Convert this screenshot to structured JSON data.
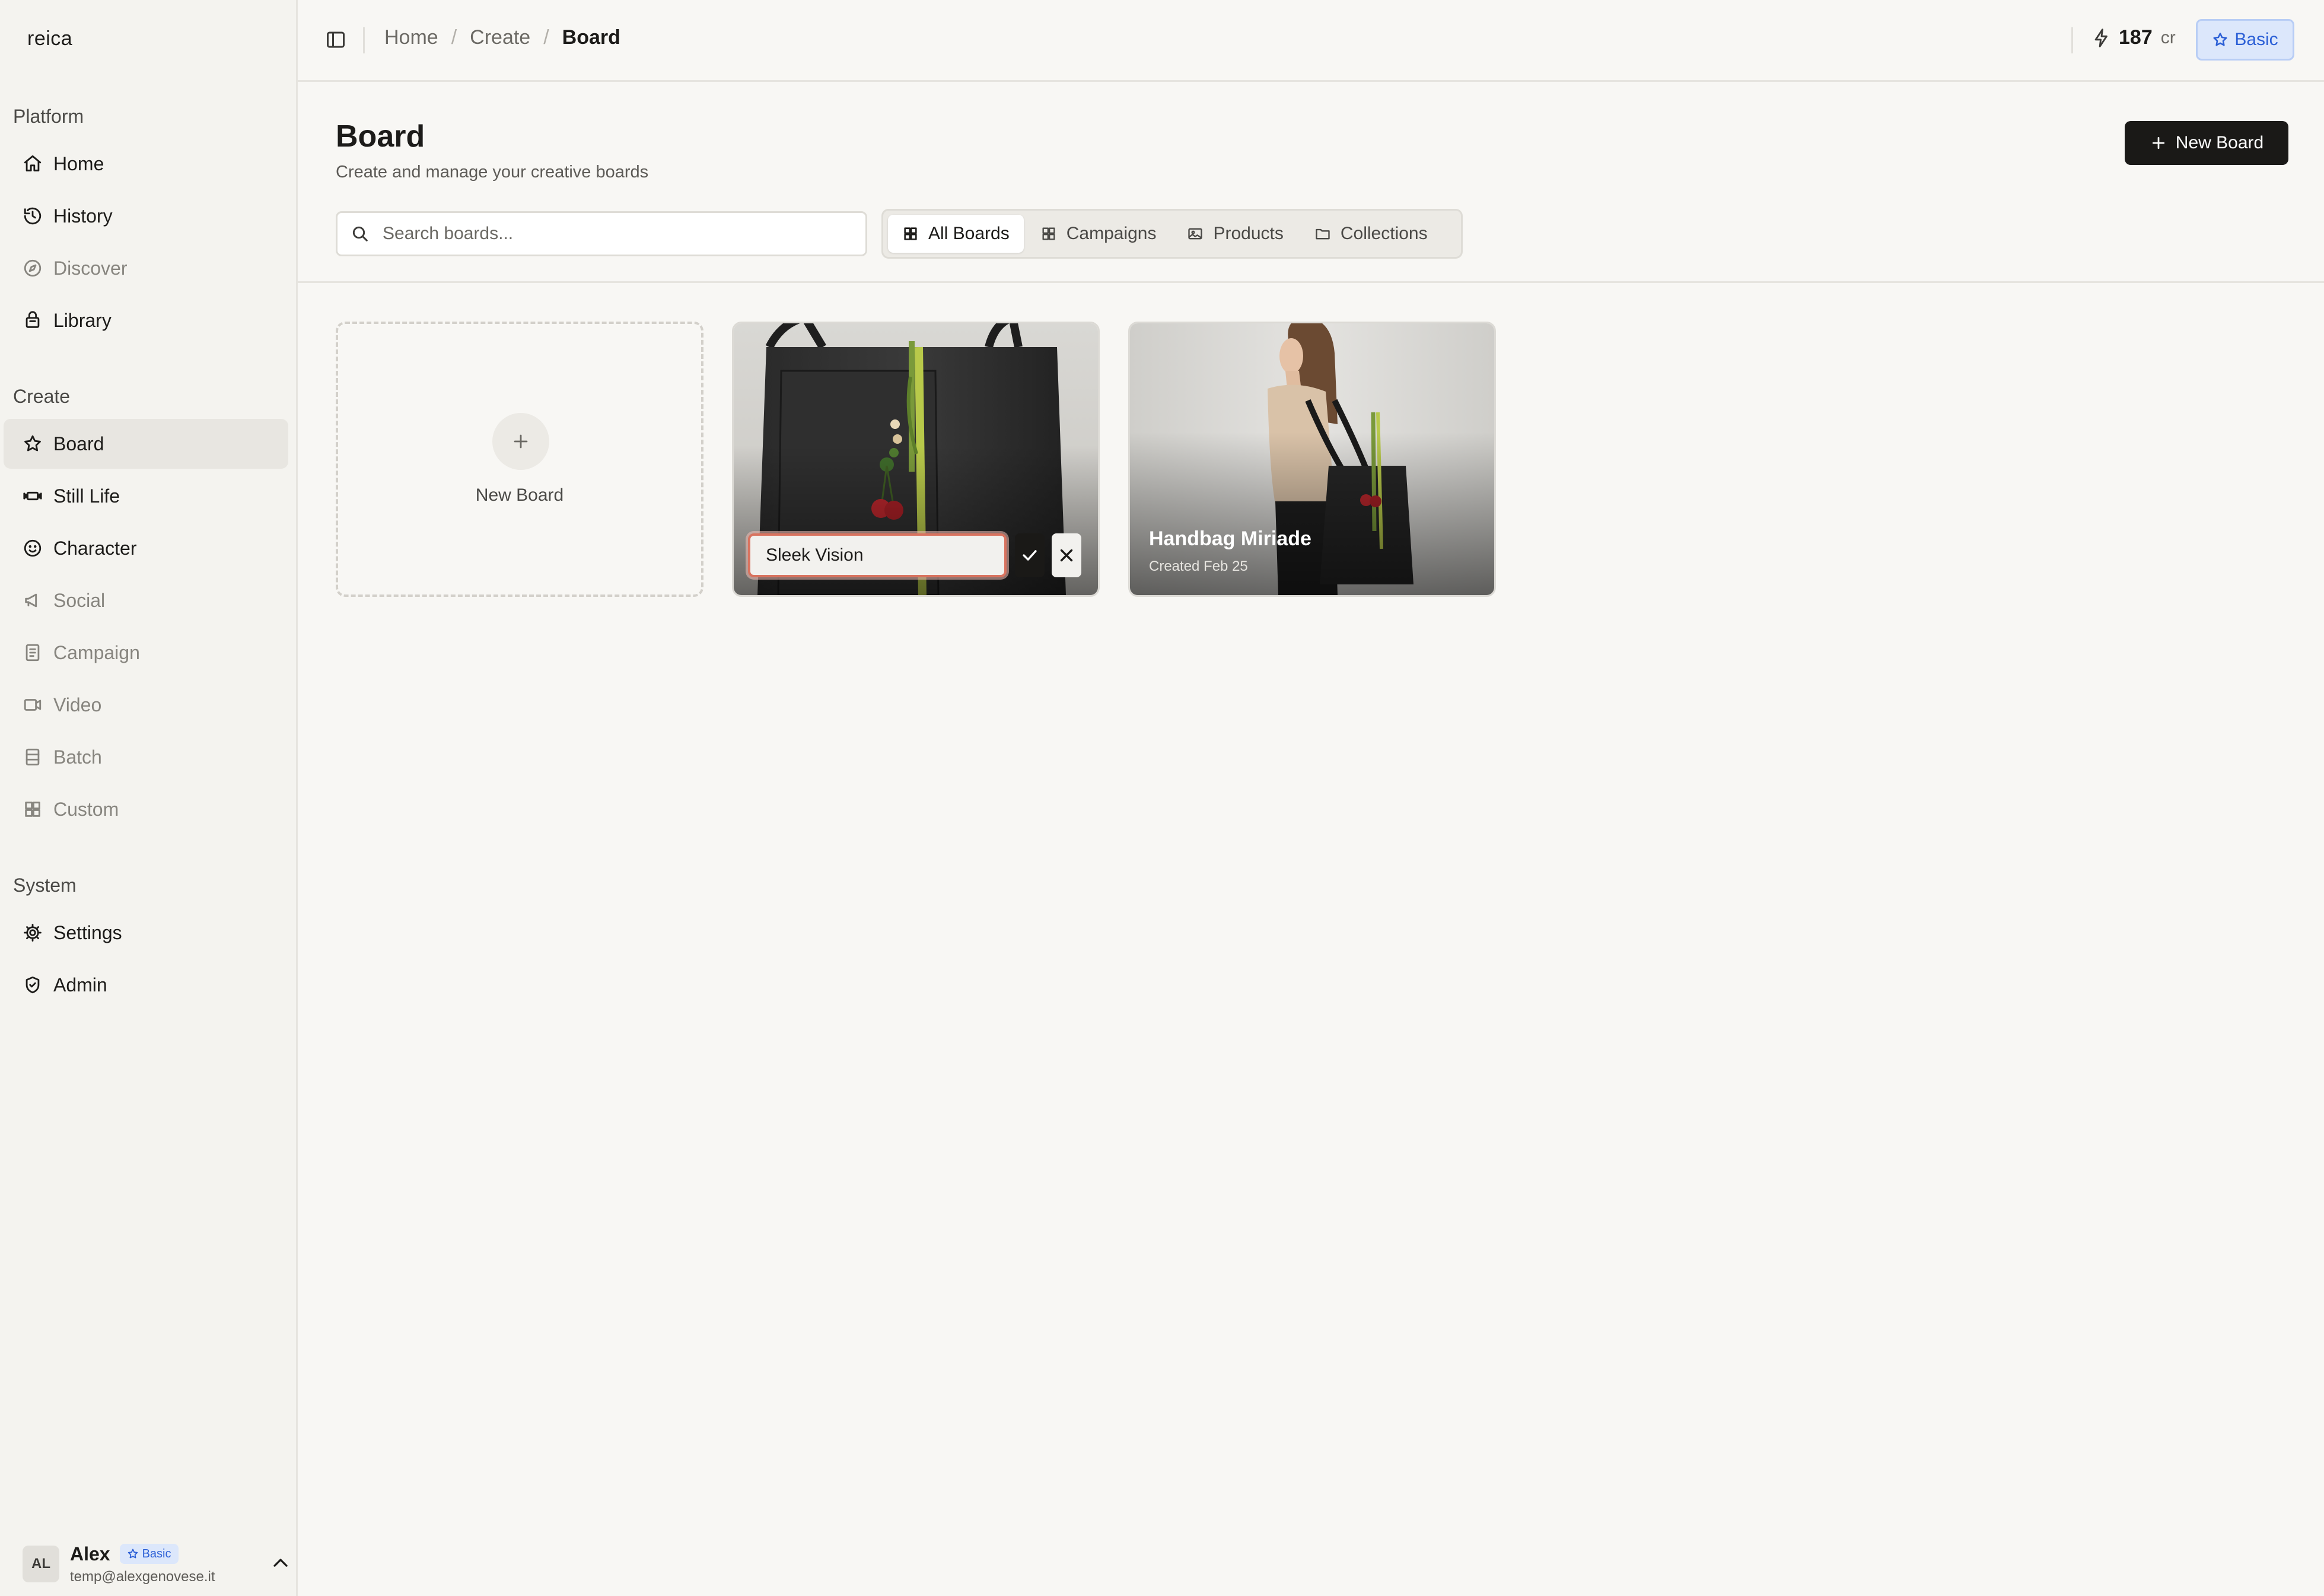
{
  "app": {
    "logo": "reica"
  },
  "sidebar": {
    "sections": [
      {
        "label": "Platform"
      },
      {
        "label": "Create"
      },
      {
        "label": "System"
      }
    ],
    "platform_items": [
      {
        "label": "Home",
        "icon": "home-icon"
      },
      {
        "label": "History",
        "icon": "history-icon"
      },
      {
        "label": "Discover",
        "icon": "compass-icon"
      },
      {
        "label": "Library",
        "icon": "library-icon"
      }
    ],
    "create_items": [
      {
        "label": "Board",
        "icon": "star-icon",
        "active": true
      },
      {
        "label": "Still Life",
        "icon": "still-life-icon"
      },
      {
        "label": "Character",
        "icon": "character-icon"
      },
      {
        "label": "Social",
        "icon": "megaphone-icon"
      },
      {
        "label": "Campaign",
        "icon": "campaign-icon"
      },
      {
        "label": "Video",
        "icon": "video-icon"
      },
      {
        "label": "Batch",
        "icon": "batch-icon"
      },
      {
        "label": "Custom",
        "icon": "grid-icon"
      }
    ],
    "system_items": [
      {
        "label": "Settings",
        "icon": "gear-icon"
      },
      {
        "label": "Admin",
        "icon": "shield-icon"
      }
    ],
    "user": {
      "initials": "AL",
      "name": "Alex",
      "badge": "Basic",
      "email": "temp@alexgenovese.it"
    }
  },
  "topbar": {
    "breadcrumb": [
      "Home",
      "Create",
      "Board"
    ],
    "separator": "/",
    "credits": "187",
    "credits_unit": "cr",
    "plan": "Basic"
  },
  "header": {
    "title": "Board",
    "subtitle": "Create and manage your creative boards",
    "new_button": "New Board"
  },
  "search": {
    "placeholder": "Search boards..."
  },
  "filters": [
    {
      "label": "All Boards",
      "icon": "grid-icon",
      "active": true
    },
    {
      "label": "Campaigns",
      "icon": "grid-icon"
    },
    {
      "label": "Products",
      "icon": "image-icon"
    },
    {
      "label": "Collections",
      "icon": "folder-icon"
    }
  ],
  "cards": {
    "new_card_label": "New Board",
    "items": [
      {
        "editing": true,
        "rename_value": "Sleek Vision"
      },
      {
        "title": "Handbag Miriade",
        "created": "Created Feb 25"
      }
    ]
  },
  "colors": {
    "accent_dark": "#1a1917",
    "badge_blue": "#2b5fd6",
    "badge_bg": "#dce7fb",
    "rename_border": "#d9735f"
  }
}
